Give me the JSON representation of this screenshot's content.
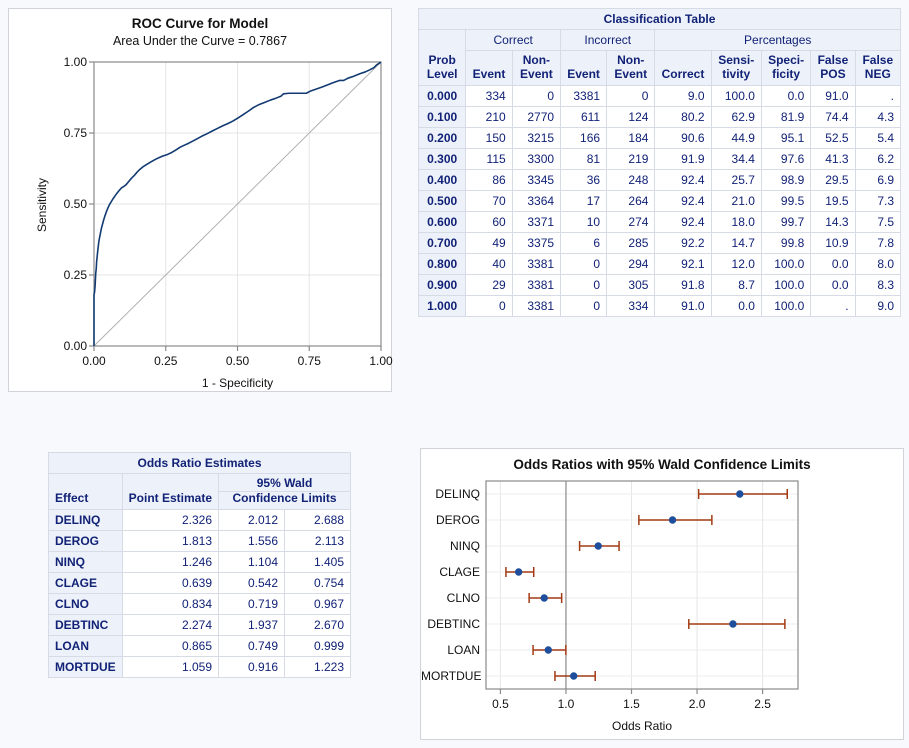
{
  "roc_panel": {
    "title": "ROC Curve for Model",
    "subtitle": "Area Under the Curve = 0.7867"
  },
  "classification": {
    "title": "Classification Table",
    "group_headers": [
      "Correct",
      "Incorrect",
      "Percentages"
    ],
    "columns": [
      "Prob Level",
      "Event",
      "Non-Event",
      "Event",
      "Non-Event",
      "Correct",
      "Sensi-tivity",
      "Speci-ficity",
      "False POS",
      "False NEG"
    ],
    "columns_l1": [
      "Prob",
      "",
      "Non-",
      "",
      "Non-",
      "",
      "Sensi-",
      "Speci-",
      "False",
      "False"
    ],
    "columns_l2": [
      "Level",
      "Event",
      "Event",
      "Event",
      "Event",
      "Correct",
      "tivity",
      "ficity",
      "POS",
      "NEG"
    ],
    "rows": [
      [
        "0.000",
        "334",
        "0",
        "3381",
        "0",
        "9.0",
        "100.0",
        "0.0",
        "91.0",
        "."
      ],
      [
        "0.100",
        "210",
        "2770",
        "611",
        "124",
        "80.2",
        "62.9",
        "81.9",
        "74.4",
        "4.3"
      ],
      [
        "0.200",
        "150",
        "3215",
        "166",
        "184",
        "90.6",
        "44.9",
        "95.1",
        "52.5",
        "5.4"
      ],
      [
        "0.300",
        "115",
        "3300",
        "81",
        "219",
        "91.9",
        "34.4",
        "97.6",
        "41.3",
        "6.2"
      ],
      [
        "0.400",
        "86",
        "3345",
        "36",
        "248",
        "92.4",
        "25.7",
        "98.9",
        "29.5",
        "6.9"
      ],
      [
        "0.500",
        "70",
        "3364",
        "17",
        "264",
        "92.4",
        "21.0",
        "99.5",
        "19.5",
        "7.3"
      ],
      [
        "0.600",
        "60",
        "3371",
        "10",
        "274",
        "92.4",
        "18.0",
        "99.7",
        "14.3",
        "7.5"
      ],
      [
        "0.700",
        "49",
        "3375",
        "6",
        "285",
        "92.2",
        "14.7",
        "99.8",
        "10.9",
        "7.8"
      ],
      [
        "0.800",
        "40",
        "3381",
        "0",
        "294",
        "92.1",
        "12.0",
        "100.0",
        "0.0",
        "8.0"
      ],
      [
        "0.900",
        "29",
        "3381",
        "0",
        "305",
        "91.8",
        "8.7",
        "100.0",
        "0.0",
        "8.3"
      ],
      [
        "1.000",
        "0",
        "3381",
        "0",
        "334",
        "91.0",
        "0.0",
        "100.0",
        ".",
        "9.0"
      ]
    ]
  },
  "odds_table": {
    "title": "Odds Ratio Estimates",
    "col_effect": "Effect",
    "col_point": "Point Estimate",
    "col_ci_l1": "95% Wald",
    "col_ci_l2": "Confidence Limits",
    "rows": [
      [
        "DELINQ",
        "2.326",
        "2.012",
        "2.688"
      ],
      [
        "DEROG",
        "1.813",
        "1.556",
        "2.113"
      ],
      [
        "NINQ",
        "1.246",
        "1.104",
        "1.405"
      ],
      [
        "CLAGE",
        "0.639",
        "0.542",
        "0.754"
      ],
      [
        "CLNO",
        "0.834",
        "0.719",
        "0.967"
      ],
      [
        "DEBTINC",
        "2.274",
        "1.937",
        "2.670"
      ],
      [
        "LOAN",
        "0.865",
        "0.749",
        "0.999"
      ],
      [
        "MORTDUE",
        "1.059",
        "0.916",
        "1.223"
      ]
    ]
  },
  "chart_data": [
    {
      "type": "line",
      "name": "roc-curve",
      "title": "ROC Curve for Model",
      "subtitle": "Area Under the Curve = 0.7867",
      "auc": 0.7867,
      "xlabel": "1 - Specificity",
      "ylabel": "Sensitivity",
      "xlim": [
        0.0,
        1.0
      ],
      "ylim": [
        0.0,
        1.0
      ],
      "xticks": [
        "0.00",
        "0.25",
        "0.50",
        "0.75",
        "1.00"
      ],
      "yticks": [
        "0.00",
        "0.25",
        "0.50",
        "0.75",
        "1.00"
      ],
      "grid": true,
      "legend": "none",
      "series": [
        {
          "name": "ROC",
          "color": "#123a72",
          "points": [
            [
              0.0,
              0.0
            ],
            [
              0.0,
              0.06
            ],
            [
              0.0,
              0.12
            ],
            [
              0.0,
              0.18
            ],
            [
              0.002,
              0.19
            ],
            [
              0.004,
              0.215
            ],
            [
              0.005,
              0.235
            ],
            [
              0.006,
              0.255
            ],
            [
              0.008,
              0.275
            ],
            [
              0.009,
              0.295
            ],
            [
              0.011,
              0.315
            ],
            [
              0.013,
              0.335
            ],
            [
              0.015,
              0.352
            ],
            [
              0.017,
              0.368
            ],
            [
              0.02,
              0.385
            ],
            [
              0.023,
              0.4
            ],
            [
              0.026,
              0.415
            ],
            [
              0.03,
              0.43
            ],
            [
              0.034,
              0.445
            ],
            [
              0.038,
              0.458
            ],
            [
              0.043,
              0.472
            ],
            [
              0.048,
              0.485
            ],
            [
              0.054,
              0.498
            ],
            [
              0.06,
              0.508
            ],
            [
              0.066,
              0.518
            ],
            [
              0.073,
              0.528
            ],
            [
              0.08,
              0.538
            ],
            [
              0.088,
              0.548
            ],
            [
              0.096,
              0.557
            ],
            [
              0.104,
              0.562
            ],
            [
              0.112,
              0.568
            ],
            [
              0.12,
              0.578
            ],
            [
              0.13,
              0.59
            ],
            [
              0.14,
              0.6
            ],
            [
              0.15,
              0.612
            ],
            [
              0.16,
              0.622
            ],
            [
              0.172,
              0.632
            ],
            [
              0.185,
              0.64
            ],
            [
              0.198,
              0.648
            ],
            [
              0.212,
              0.656
            ],
            [
              0.226,
              0.663
            ],
            [
              0.24,
              0.669
            ],
            [
              0.255,
              0.674
            ],
            [
              0.27,
              0.681
            ],
            [
              0.285,
              0.69
            ],
            [
              0.3,
              0.7
            ],
            [
              0.315,
              0.707
            ],
            [
              0.33,
              0.714
            ],
            [
              0.345,
              0.722
            ],
            [
              0.36,
              0.73
            ],
            [
              0.378,
              0.74
            ],
            [
              0.395,
              0.748
            ],
            [
              0.412,
              0.757
            ],
            [
              0.43,
              0.766
            ],
            [
              0.448,
              0.775
            ],
            [
              0.466,
              0.783
            ],
            [
              0.484,
              0.792
            ],
            [
              0.502,
              0.803
            ],
            [
              0.52,
              0.815
            ],
            [
              0.538,
              0.827
            ],
            [
              0.556,
              0.84
            ],
            [
              0.575,
              0.85
            ],
            [
              0.595,
              0.858
            ],
            [
              0.615,
              0.866
            ],
            [
              0.635,
              0.873
            ],
            [
              0.652,
              0.88
            ],
            [
              0.66,
              0.888
            ],
            [
              0.68,
              0.89
            ],
            [
              0.7,
              0.89
            ],
            [
              0.72,
              0.89
            ],
            [
              0.74,
              0.89
            ],
            [
              0.755,
              0.898
            ],
            [
              0.775,
              0.905
            ],
            [
              0.795,
              0.912
            ],
            [
              0.815,
              0.92
            ],
            [
              0.835,
              0.928
            ],
            [
              0.855,
              0.935
            ],
            [
              0.87,
              0.935
            ],
            [
              0.885,
              0.943
            ],
            [
              0.905,
              0.95
            ],
            [
              0.925,
              0.958
            ],
            [
              0.945,
              0.965
            ],
            [
              0.96,
              0.972
            ],
            [
              0.975,
              0.98
            ],
            [
              0.985,
              0.99
            ],
            [
              0.993,
              0.995
            ],
            [
              1.0,
              1.0
            ]
          ]
        },
        {
          "name": "Reference Diagonal",
          "color": "#b0b0b0",
          "points": [
            [
              0.0,
              0.0
            ],
            [
              1.0,
              1.0
            ]
          ]
        }
      ]
    },
    {
      "type": "scatter",
      "name": "odds-ratio-forest-plot",
      "title": "Odds Ratios with 95% Wald Confidence Limits",
      "xlabel": "Odds Ratio",
      "ylabel": "",
      "xlim": [
        0.39,
        2.77
      ],
      "xticks": [
        "0.5",
        "1.0",
        "1.5",
        "2.0",
        "2.5"
      ],
      "xtick_values": [
        0.5,
        1.0,
        1.5,
        2.0,
        2.5
      ],
      "reference_line": 1.0,
      "grid": true,
      "legend": "none",
      "marker_color": "#1f4e9c",
      "line_color": "#a33a12",
      "categories": [
        "DELINQ",
        "DEROG",
        "NINQ",
        "CLAGE",
        "CLNO",
        "DEBTINC",
        "LOAN",
        "MORTDUE"
      ],
      "estimates": [
        2.326,
        1.813,
        1.246,
        0.639,
        0.834,
        2.274,
        0.865,
        1.059
      ],
      "lower": [
        2.012,
        1.556,
        1.104,
        0.542,
        0.719,
        1.937,
        0.749,
        0.916
      ],
      "upper": [
        2.688,
        2.113,
        1.405,
        0.754,
        0.967,
        2.67,
        0.999,
        1.223
      ]
    }
  ]
}
